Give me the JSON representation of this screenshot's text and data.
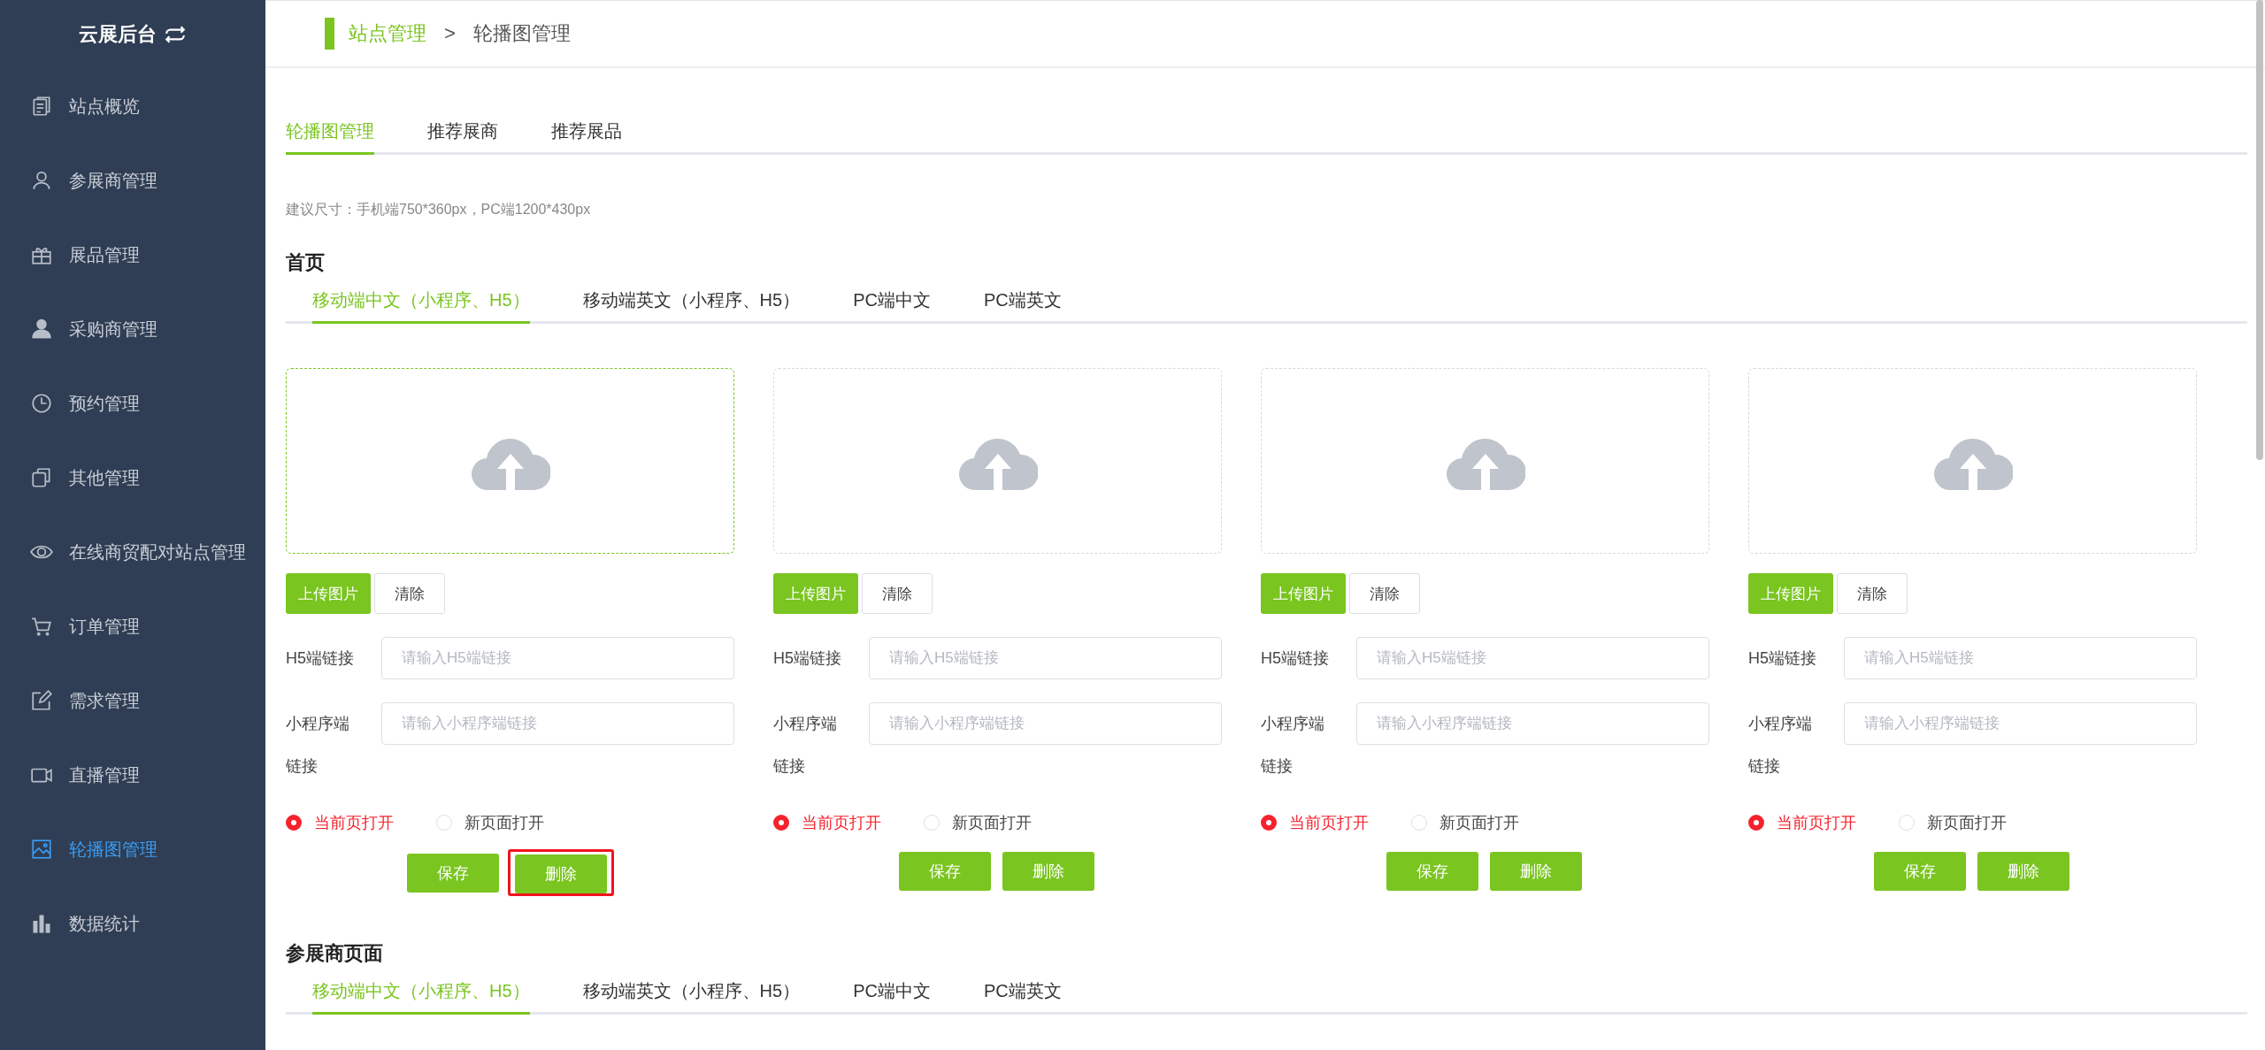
{
  "sidebar": {
    "title": "云展后台",
    "items": [
      {
        "label": "站点概览",
        "kind": "doc",
        "selected": false
      },
      {
        "label": "参展商管理",
        "kind": "user",
        "selected": false
      },
      {
        "label": "展品管理",
        "kind": "gift",
        "selected": false
      },
      {
        "label": "采购商管理",
        "kind": "person",
        "selected": false
      },
      {
        "label": "预约管理",
        "kind": "clock",
        "selected": false
      },
      {
        "label": "其他管理",
        "kind": "copy",
        "selected": false
      },
      {
        "label": "在线商贸配对站点管理",
        "kind": "eye",
        "selected": false
      },
      {
        "label": "订单管理",
        "kind": "cart",
        "selected": false
      },
      {
        "label": "需求管理",
        "kind": "edit",
        "selected": false
      },
      {
        "label": "直播管理",
        "kind": "video",
        "selected": false
      },
      {
        "label": "轮播图管理",
        "kind": "image",
        "selected": true
      },
      {
        "label": "数据统计",
        "kind": "chart",
        "selected": false
      }
    ]
  },
  "breadcrumb": {
    "parent": "站点管理",
    "separator": ">",
    "current": "轮播图管理"
  },
  "tabs": [
    {
      "label": "轮播图管理",
      "selected": true
    },
    {
      "label": "推荐展商",
      "selected": false
    },
    {
      "label": "推荐展品",
      "selected": false
    }
  ],
  "hint": "建议尺寸：手机端750*360px，PC端1200*430px",
  "sections": [
    {
      "title": "首页",
      "tabs": [
        {
          "label": "移动端中文（小程序、H5）",
          "selected": true
        },
        {
          "label": "移动端英文（小程序、H5）",
          "selected": false
        },
        {
          "label": "PC端中文",
          "selected": false
        },
        {
          "label": "PC端英文",
          "selected": false
        }
      ],
      "cards": [
        {
          "focused": true,
          "upload": "上传图片",
          "clear": "清除",
          "fields": [
            {
              "label": "H5端链接",
              "placeholder": "请输入H5端链接"
            },
            {
              "label": "小程序端链接",
              "placeholder": "请输入小程序端链接"
            }
          ],
          "options": [
            {
              "label": "当前页打开",
              "selected": true
            },
            {
              "label": "新页面打开",
              "selected": false
            }
          ],
          "save": "保存",
          "delete": "删除",
          "highlighted": true
        },
        {
          "focused": false,
          "upload": "上传图片",
          "clear": "清除",
          "fields": [
            {
              "label": "H5端链接",
              "placeholder": "请输入H5端链接"
            },
            {
              "label": "小程序端链接",
              "placeholder": "请输入小程序端链接"
            }
          ],
          "options": [
            {
              "label": "当前页打开",
              "selected": true
            },
            {
              "label": "新页面打开",
              "selected": false
            }
          ],
          "save": "保存",
          "delete": "删除",
          "highlighted": false
        },
        {
          "focused": false,
          "upload": "上传图片",
          "clear": "清除",
          "fields": [
            {
              "label": "H5端链接",
              "placeholder": "请输入H5端链接"
            },
            {
              "label": "小程序端链接",
              "placeholder": "请输入小程序端链接"
            }
          ],
          "options": [
            {
              "label": "当前页打开",
              "selected": true
            },
            {
              "label": "新页面打开",
              "selected": false
            }
          ],
          "save": "保存",
          "delete": "删除",
          "highlighted": false
        },
        {
          "focused": false,
          "upload": "上传图片",
          "clear": "清除",
          "fields": [
            {
              "label": "H5端链接",
              "placeholder": "请输入H5端链接"
            },
            {
              "label": "小程序端链接",
              "placeholder": "请输入小程序端链接"
            }
          ],
          "options": [
            {
              "label": "当前页打开",
              "selected": true
            },
            {
              "label": "新页面打开",
              "selected": false
            }
          ],
          "save": "保存",
          "delete": "删除",
          "highlighted": false
        }
      ]
    },
    {
      "title": "参展商页面",
      "tabs": [
        {
          "label": "移动端中文（小程序、H5）",
          "selected": true
        },
        {
          "label": "移动端英文（小程序、H5）",
          "selected": false
        },
        {
          "label": "PC端中文",
          "selected": false
        },
        {
          "label": "PC端英文",
          "selected": false
        }
      ]
    }
  ]
}
